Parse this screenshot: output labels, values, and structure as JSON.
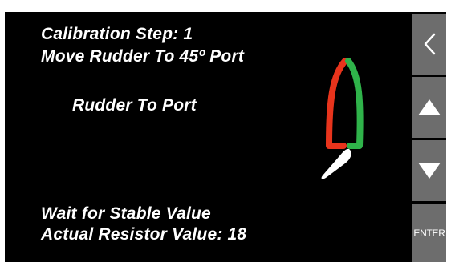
{
  "calibration": {
    "step_text": "Calibration Step: 1",
    "instruction": "Move Rudder To 45º Port",
    "status": "Rudder To Port",
    "wait_text": "Wait for Stable Value",
    "resistor_text": "Actual Resistor Value: 18"
  },
  "buttons": {
    "back_icon": "chevron-left-icon",
    "up_icon": "triangle-up-icon",
    "down_icon": "triangle-down-icon",
    "enter_label": "ENTER"
  },
  "colors": {
    "background": "#000000",
    "button": "#6d6d6d",
    "port": "#e8341c",
    "starboard": "#2fb34a",
    "rudder": "#ffffff"
  }
}
